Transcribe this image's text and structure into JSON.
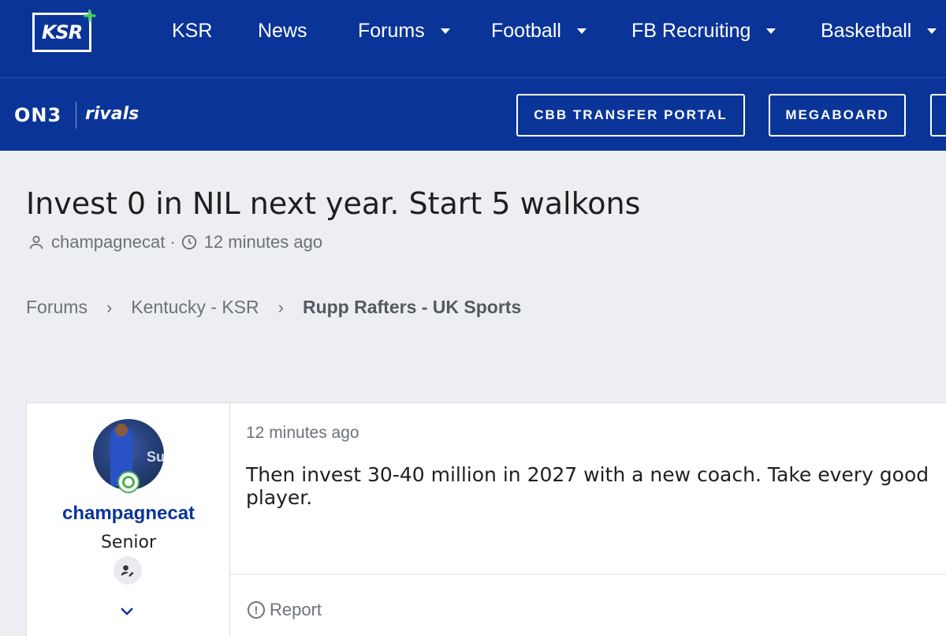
{
  "nav": {
    "logo_text": "KSR",
    "items": [
      {
        "label": "KSR",
        "dropdown": false
      },
      {
        "label": "News",
        "dropdown": false
      },
      {
        "label": "Forums",
        "dropdown": true
      },
      {
        "label": "Football",
        "dropdown": true
      },
      {
        "label": "FB Recruiting",
        "dropdown": true
      },
      {
        "label": "Basketball",
        "dropdown": true
      }
    ]
  },
  "subnav": {
    "on3_label": "ON3",
    "rivals_label": "rivals",
    "buttons": [
      "CBB TRANSFER PORTAL",
      "MEGABOARD"
    ]
  },
  "thread": {
    "title": "Invest 0 in NIL next year. Start 5 walkons",
    "author": "champagnecat",
    "time": "12 minutes ago"
  },
  "breadcrumb": {
    "items": [
      "Forums",
      "Kentucky - KSR"
    ],
    "current": "Rupp Rafters - UK Sports"
  },
  "post": {
    "username": "champagnecat",
    "user_title": "Senior",
    "avatar_text": "Su",
    "time": "12 minutes ago",
    "body": "Then invest 30-40 million in 2027 with a new coach. Take every good player.",
    "report_label": "Report"
  },
  "colors": {
    "brand": "#0a3498",
    "online": "#4caf50",
    "plus": "#3fd35a"
  }
}
